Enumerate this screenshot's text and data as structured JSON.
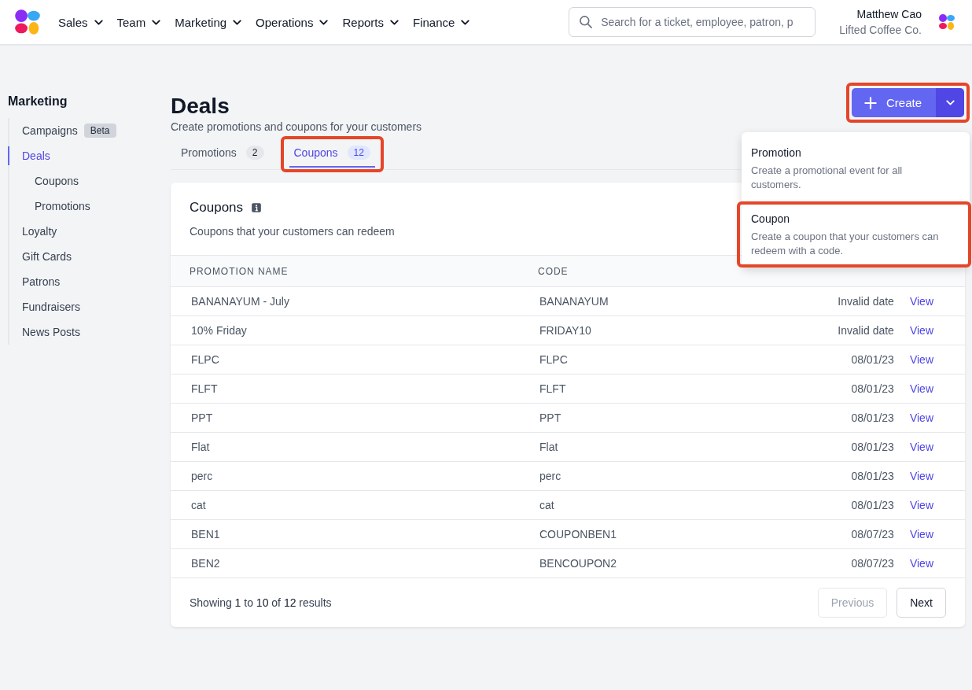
{
  "nav": {
    "items": [
      {
        "label": "Sales"
      },
      {
        "label": "Team"
      },
      {
        "label": "Marketing"
      },
      {
        "label": "Operations"
      },
      {
        "label": "Reports"
      },
      {
        "label": "Finance"
      }
    ],
    "search": {
      "placeholder": "Search for a ticket, employee, patron, p"
    },
    "user": {
      "name": "Matthew Cao",
      "company": "Lifted Coffee Co."
    }
  },
  "sidebar": {
    "title": "Marketing",
    "items": [
      {
        "label": "Campaigns",
        "badge": "Beta",
        "selected": false
      },
      {
        "label": "Deals",
        "selected": true,
        "children": [
          {
            "label": "Coupons",
            "selected": false
          },
          {
            "label": "Promotions",
            "selected": false
          }
        ]
      },
      {
        "label": "Loyalty",
        "selected": false
      },
      {
        "label": "Gift Cards",
        "selected": false
      },
      {
        "label": "Patrons",
        "selected": false
      },
      {
        "label": "Fundraisers",
        "selected": false
      },
      {
        "label": "News Posts",
        "selected": false
      }
    ]
  },
  "page": {
    "title": "Deals",
    "subtitle": "Create promotions and coupons for your customers"
  },
  "tabs": [
    {
      "label": "Promotions",
      "count": "2",
      "selected": false,
      "highlighted": false
    },
    {
      "label": "Coupons",
      "count": "12",
      "selected": true,
      "highlighted": true
    }
  ],
  "create_button": {
    "label": "Create",
    "highlighted": true
  },
  "create_menu": [
    {
      "title": "Promotion",
      "description": "Create a promotional event for all customers.",
      "highlighted": false
    },
    {
      "title": "Coupon",
      "description": "Create a coupon that your customers can redeem with a code.",
      "highlighted": true
    }
  ],
  "card": {
    "title": "Coupons",
    "subtitle": "Coupons that your customers can redeem"
  },
  "table": {
    "columns": [
      "PROMOTION NAME",
      "CODE"
    ],
    "rows": [
      [
        "BANANAYUM - July",
        "BANANAYUM",
        "Invalid date",
        "View"
      ],
      [
        "10% Friday",
        "FRIDAY10",
        "Invalid date",
        "View"
      ],
      [
        "FLPC",
        "FLPC",
        "08/01/23",
        "View"
      ],
      [
        "FLFT",
        "FLFT",
        "08/01/23",
        "View"
      ],
      [
        "PPT",
        "PPT",
        "08/01/23",
        "View"
      ],
      [
        "Flat",
        "Flat",
        "08/01/23",
        "View"
      ],
      [
        "perc",
        "perc",
        "08/01/23",
        "View"
      ],
      [
        "cat",
        "cat",
        "08/01/23",
        "View"
      ],
      [
        "BEN1",
        "COUPONBEN1",
        "08/07/23",
        "View"
      ],
      [
        "BEN2",
        "BENCOUPON2",
        "08/07/23",
        "View"
      ]
    ]
  },
  "pagination": {
    "summary": "Showing **1** to **10** of **12** results",
    "previous": {
      "label": "Previous",
      "disabled": true
    },
    "next": {
      "label": "Next",
      "disabled": false
    }
  }
}
